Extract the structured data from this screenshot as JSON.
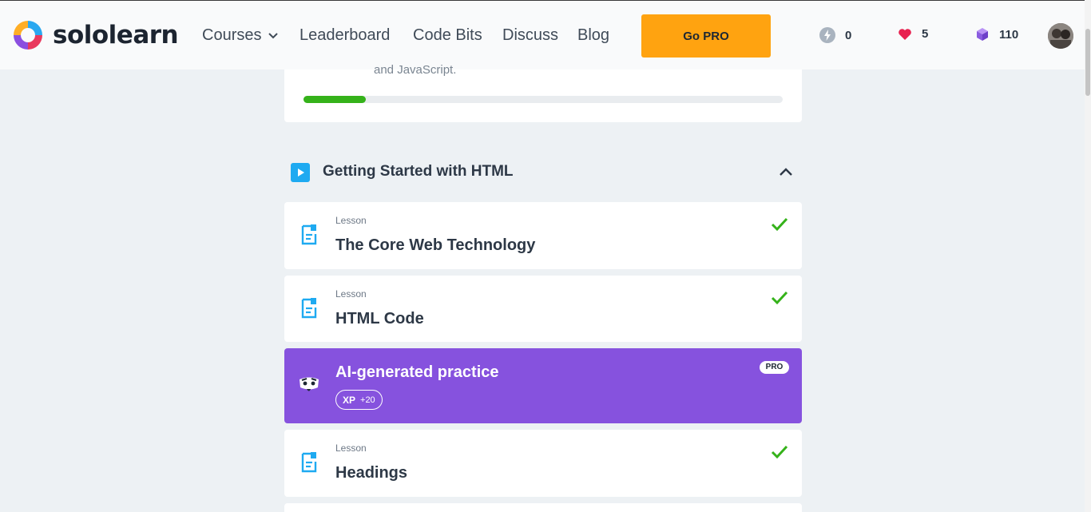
{
  "brand": {
    "name": "sololearn"
  },
  "nav": {
    "courses": "Courses",
    "leaderboard": "Leaderboard",
    "code_bits": "Code Bits",
    "discuss": "Discuss",
    "blog": "Blog",
    "go_pro": "Go PRO"
  },
  "stats": {
    "streak": "0",
    "hearts": "5",
    "gems": "110"
  },
  "colors": {
    "accent_orange": "#ffa310",
    "ai_purple": "#8652de",
    "progress_green": "#35b21a",
    "icon_blue": "#1eaaf1"
  },
  "course": {
    "intro_text": "and JavaScript.",
    "progress_fraction": 0.13
  },
  "section": {
    "title": "Getting Started with HTML"
  },
  "items": [
    {
      "type": "Lesson",
      "title": "The Core Web Technology",
      "completed": true
    },
    {
      "type": "Lesson",
      "title": "HTML Code",
      "completed": true
    },
    {
      "type": "Lesson",
      "title": "Headings",
      "completed": true
    }
  ],
  "ai_practice": {
    "title": "AI-generated practice",
    "xp_label": "XP",
    "xp_value": "+20",
    "badge": "PRO"
  }
}
